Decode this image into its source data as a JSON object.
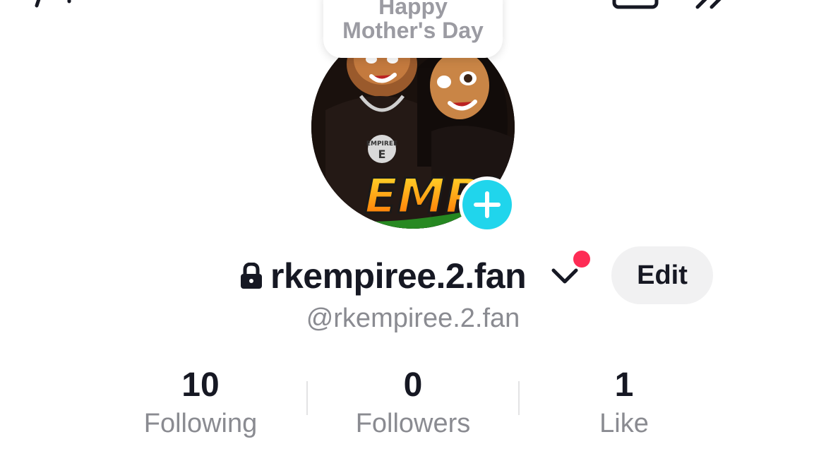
{
  "note": {
    "line1": "Happy",
    "line2": "Mother's Day"
  },
  "profile": {
    "display_name": "rkempiree.2.fan",
    "handle": "@rkempiree.2.fan",
    "edit_label": "Edit",
    "avatar_text": "EMPI",
    "avatar_pendant": "EMPIREE"
  },
  "stats": [
    {
      "value": "10",
      "label": "Following"
    },
    {
      "value": "0",
      "label": "Followers"
    },
    {
      "value": "1",
      "label": "Like"
    }
  ],
  "icons": {
    "lock": "lock-icon",
    "chevron": "chevron-down-icon",
    "add": "plus-icon"
  },
  "colors": {
    "accent_add": "#20d5ec",
    "notification_dot": "#fe2c55",
    "edit_button_bg": "#f1f1f2",
    "secondary_text": "#8a8b91"
  }
}
